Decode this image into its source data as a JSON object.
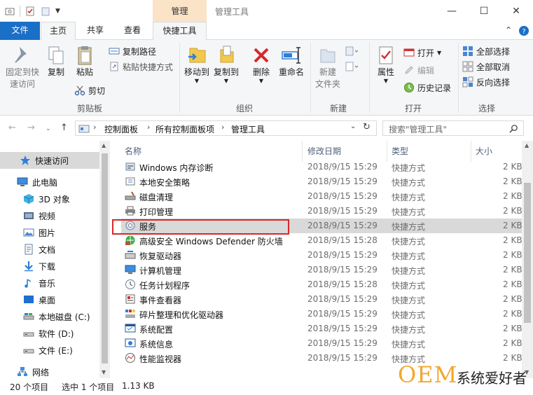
{
  "window": {
    "title": "管理工具",
    "context_tab_top": "管理",
    "buttons": {
      "minimize": "—",
      "maximize": "☐",
      "close": "✕"
    }
  },
  "tabs": {
    "file": "文件",
    "home": "主页",
    "share": "共享",
    "view": "查看",
    "ctx": "快捷工具"
  },
  "ribbon": {
    "clipboard": {
      "label": "剪贴板",
      "pin": "固定到快",
      "pin2": "速访问",
      "copy": "复制",
      "paste": "粘贴",
      "copy_path": "复制路径",
      "paste_shortcut": "粘贴快捷方式",
      "cut": "剪切"
    },
    "organize": {
      "label": "组织",
      "move_to": "移动到",
      "copy_to": "复制到",
      "delete": "删除",
      "rename": "重命名"
    },
    "new": {
      "label": "新建",
      "new_folder": "新建",
      "new_folder2": "文件夹"
    },
    "open": {
      "label": "打开",
      "properties": "属性",
      "open": "打开",
      "edit": "编辑",
      "history": "历史记录"
    },
    "select": {
      "label": "选择",
      "select_all": "全部选择",
      "select_none": "全部取消",
      "invert": "反向选择"
    }
  },
  "address": {
    "crumbs": [
      "控制面板",
      "所有控制面板项",
      "管理工具"
    ],
    "search_placeholder": "搜索\"管理工具\""
  },
  "sidebar": {
    "items": [
      {
        "label": "快速访问",
        "icon": "star-icon"
      },
      {
        "label": "此电脑",
        "icon": "computer-icon"
      },
      {
        "label": "3D 对象",
        "icon": "cube-icon"
      },
      {
        "label": "视频",
        "icon": "video-icon"
      },
      {
        "label": "图片",
        "icon": "picture-icon"
      },
      {
        "label": "文档",
        "icon": "document-icon"
      },
      {
        "label": "下载",
        "icon": "download-icon"
      },
      {
        "label": "音乐",
        "icon": "music-icon"
      },
      {
        "label": "桌面",
        "icon": "desktop-icon"
      },
      {
        "label": "本地磁盘 (C:)",
        "icon": "drive-icon"
      },
      {
        "label": "软件 (D:)",
        "icon": "drive-icon"
      },
      {
        "label": "文件 (E:)",
        "icon": "drive-icon"
      },
      {
        "label": "网络",
        "icon": "network-icon"
      }
    ]
  },
  "columns": {
    "name": "名称",
    "date": "修改日期",
    "type": "类型",
    "size": "大小"
  },
  "files": [
    {
      "name": "Windows 内存诊断",
      "date": "2018/9/15 15:29",
      "type": "快捷方式",
      "size": "2 KB"
    },
    {
      "name": "本地安全策略",
      "date": "2018/9/15 15:29",
      "type": "快捷方式",
      "size": "2 KB"
    },
    {
      "name": "磁盘清理",
      "date": "2018/9/15 15:29",
      "type": "快捷方式",
      "size": "2 KB"
    },
    {
      "name": "打印管理",
      "date": "2018/9/15 15:29",
      "type": "快捷方式",
      "size": "2 KB"
    },
    {
      "name": "服务",
      "date": "2018/9/15 15:29",
      "type": "快捷方式",
      "size": "2 KB"
    },
    {
      "name": "高级安全 Windows Defender 防火墙",
      "date": "2018/9/15 15:28",
      "type": "快捷方式",
      "size": "2 KB"
    },
    {
      "name": "恢复驱动器",
      "date": "2018/9/15 15:29",
      "type": "快捷方式",
      "size": "2 KB"
    },
    {
      "name": "计算机管理",
      "date": "2018/9/15 15:29",
      "type": "快捷方式",
      "size": "2 KB"
    },
    {
      "name": "任务计划程序",
      "date": "2018/9/15 15:28",
      "type": "快捷方式",
      "size": "2 KB"
    },
    {
      "name": "事件查看器",
      "date": "2018/9/15 15:29",
      "type": "快捷方式",
      "size": "2 KB"
    },
    {
      "name": "碎片整理和优化驱动器",
      "date": "2018/9/15 15:29",
      "type": "快捷方式",
      "size": "2 KB"
    },
    {
      "name": "系统配置",
      "date": "2018/9/15 15:29",
      "type": "快捷方式",
      "size": "2 KB"
    },
    {
      "name": "系统信息",
      "date": "2018/9/15 15:29",
      "type": "快捷方式",
      "size": "2 KB"
    },
    {
      "name": "性能监视器",
      "date": "2018/9/15 15:29",
      "type": "快捷方式",
      "size": "2 KB"
    }
  ],
  "status": {
    "count": "20 个项目",
    "selected": "选中 1 个项目",
    "size": "1.13 KB"
  },
  "watermark": {
    "brand": "OEM",
    "text": "系统爱好者"
  },
  "colors": {
    "accent": "#1a6fc7",
    "context_tab": "#fbe3c8",
    "highlight": "#d8282a",
    "selection": "#d9d9d9"
  }
}
